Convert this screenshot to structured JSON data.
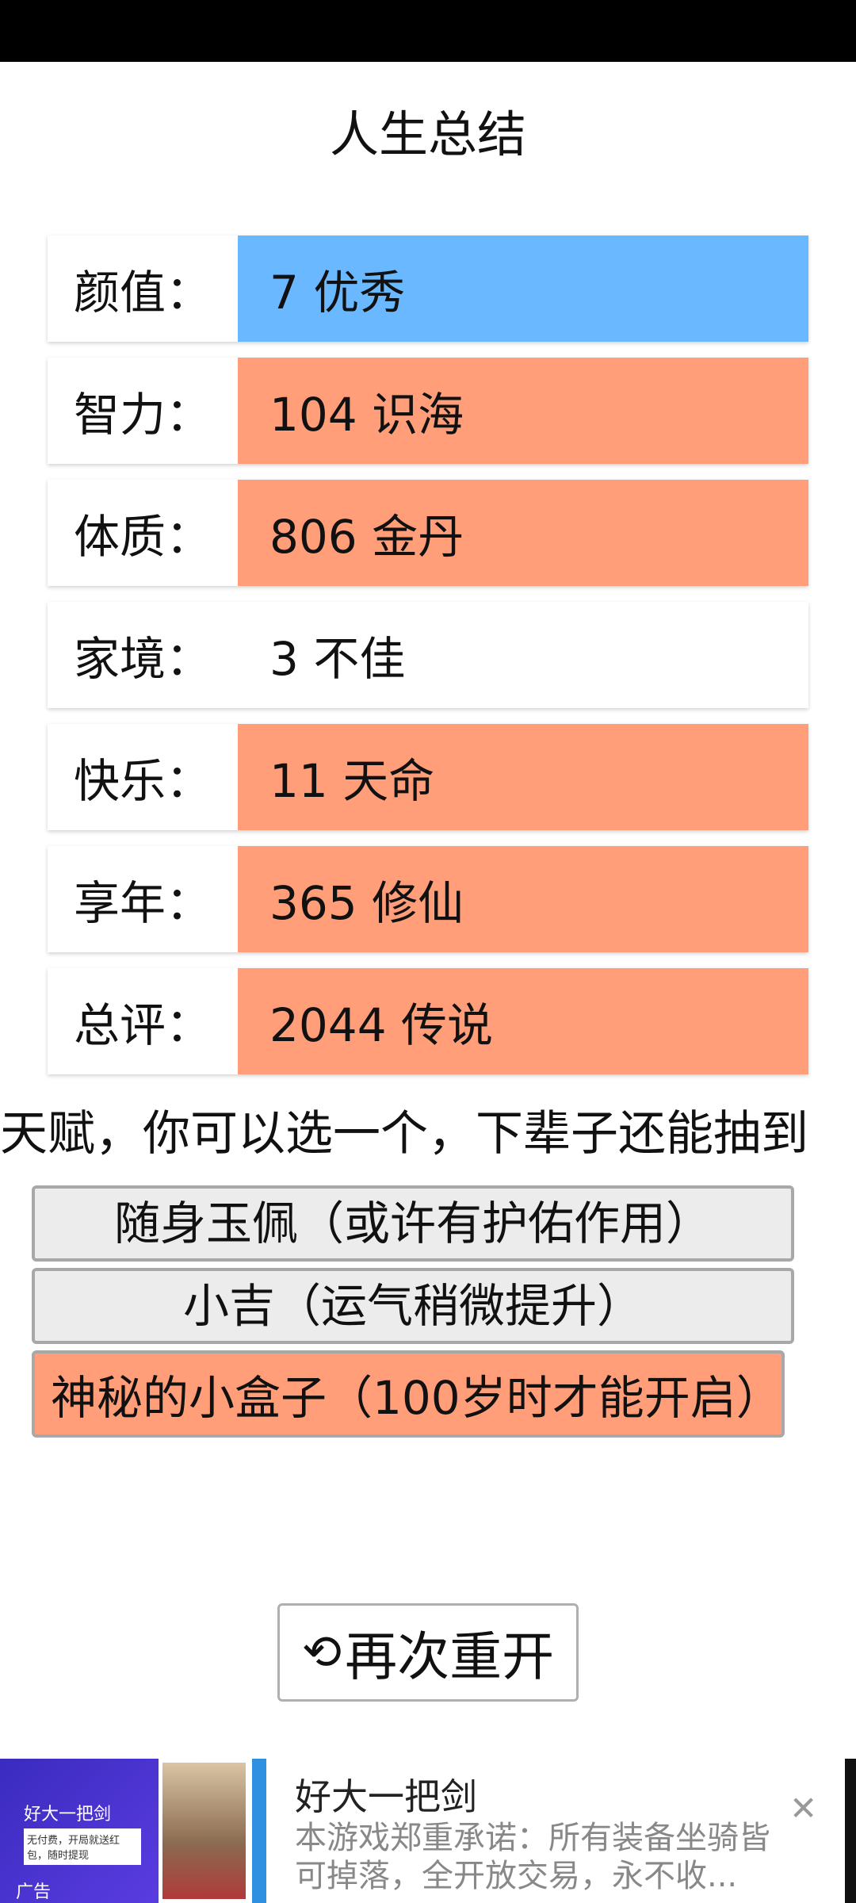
{
  "header": {
    "title": "人生总结"
  },
  "stats": [
    {
      "label": "颜值：",
      "value": "7 优秀",
      "color": "#6ab8ff"
    },
    {
      "label": "智力：",
      "value": "104 识海",
      "color": "#ff9e78"
    },
    {
      "label": "体质：",
      "value": "806 金丹",
      "color": "#ff9e78"
    },
    {
      "label": "家境：",
      "value": "3 不佳",
      "color": "#ffffff"
    },
    {
      "label": "快乐：",
      "value": "11 天命",
      "color": "#ff9e78"
    },
    {
      "label": "享年：",
      "value": "365 修仙",
      "color": "#ff9e78"
    },
    {
      "label": "总评：",
      "value": "2044 传说",
      "color": "#ff9e78"
    }
  ],
  "talent_prompt": "天赋，你可以选一个，下辈子还能抽到",
  "talents": [
    {
      "label": "随身玉佩（或许有护佑作用）",
      "selected": false
    },
    {
      "label": "小吉（运气稍微提升）",
      "selected": false
    },
    {
      "label": "神秘的小盒子（100岁时才能开启）",
      "selected": true
    }
  ],
  "restart": {
    "icon": "refresh-icon",
    "label": "再次重开"
  },
  "ad": {
    "thumb_title": "好大一把剑",
    "thumb_sub": "无付费，开局就送红包，随时提现",
    "thumb_tag": "广告",
    "title": "好大一把剑",
    "description": "本游戏郑重承诺：所有装备坐骑皆可掉落，全开放交易，永不收...",
    "close_icon": "close-icon"
  }
}
